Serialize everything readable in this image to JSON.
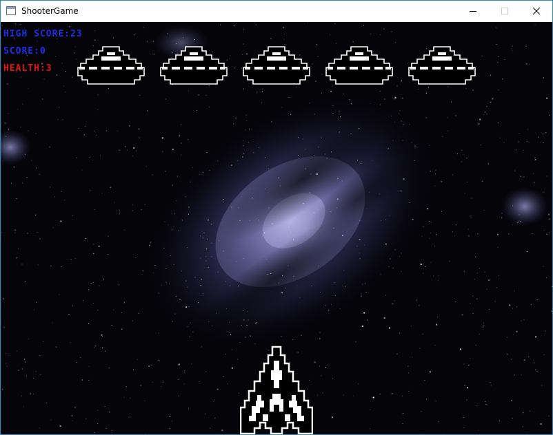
{
  "window": {
    "title": "ShooterGame",
    "app_icon": "window-app-icon",
    "controls": [
      "minimize-icon",
      "maximize-icon",
      "close-icon"
    ]
  },
  "hud": {
    "high_score": "HIGH SCORE:23",
    "score": "SCORE:0",
    "health": "HEALTH:3"
  },
  "colors": {
    "hud_blue": "#1f2ee6",
    "hud_red": "#e31414",
    "sprite_fill": "#000000",
    "sprite_outline": "#ffffff",
    "space": "#050409",
    "galaxy_glow": "#8a8ac8"
  },
  "enemies": [
    {
      "name": "enemy-ufo-1",
      "icon": "ufo-icon"
    },
    {
      "name": "enemy-ufo-2",
      "icon": "ufo-icon"
    },
    {
      "name": "enemy-ufo-3",
      "icon": "ufo-icon"
    },
    {
      "name": "enemy-ufo-4",
      "icon": "ufo-icon"
    },
    {
      "name": "enemy-ufo-5",
      "icon": "ufo-icon"
    }
  ],
  "player": {
    "icon": "player-spaceship-icon"
  }
}
